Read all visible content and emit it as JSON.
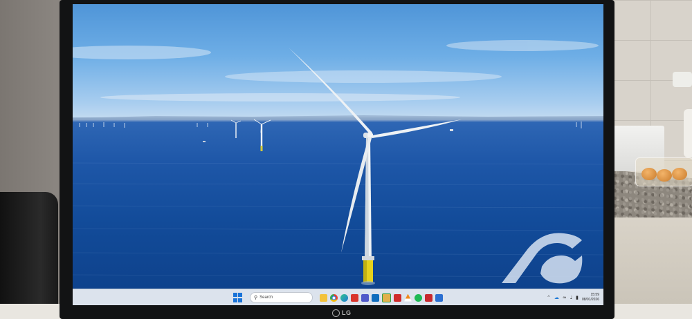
{
  "scene": {
    "description_tags": [
      "monitor",
      "wallpaper",
      "offshore-wind-turbine"
    ],
    "colors": {
      "sky_top": "#4f95d8",
      "sea": "#124b99",
      "turbine": "#eef2f5",
      "foundation": "#e6d21d",
      "logo": "#d7e3f2"
    }
  },
  "taskbar": {
    "search_label": "Search",
    "apps": [
      {
        "name": "file-explorer-icon",
        "color": "#f3c23c"
      },
      {
        "name": "chrome-icon",
        "color": "#2f9e44"
      },
      {
        "name": "edge-icon",
        "color": "#1f7ad6"
      },
      {
        "name": "app-red-icon",
        "color": "#d9342b"
      },
      {
        "name": "teams-icon",
        "color": "#5059c9"
      },
      {
        "name": "outlook-icon",
        "color": "#0f6cbd"
      },
      {
        "name": "photos-icon",
        "color": "#e1b14d"
      },
      {
        "name": "acrobat-icon",
        "color": "#d02b2b"
      },
      {
        "name": "vlc-icon",
        "color": "#f08a1c"
      },
      {
        "name": "spotify-icon",
        "color": "#1db954"
      },
      {
        "name": "pdf-icon",
        "color": "#c8282e"
      },
      {
        "name": "app-blue-icon",
        "color": "#2b6fd1"
      }
    ],
    "clock": {
      "time": "15:59",
      "date": "08/01/2026"
    }
  },
  "monitor": {
    "brand": "LG"
  }
}
